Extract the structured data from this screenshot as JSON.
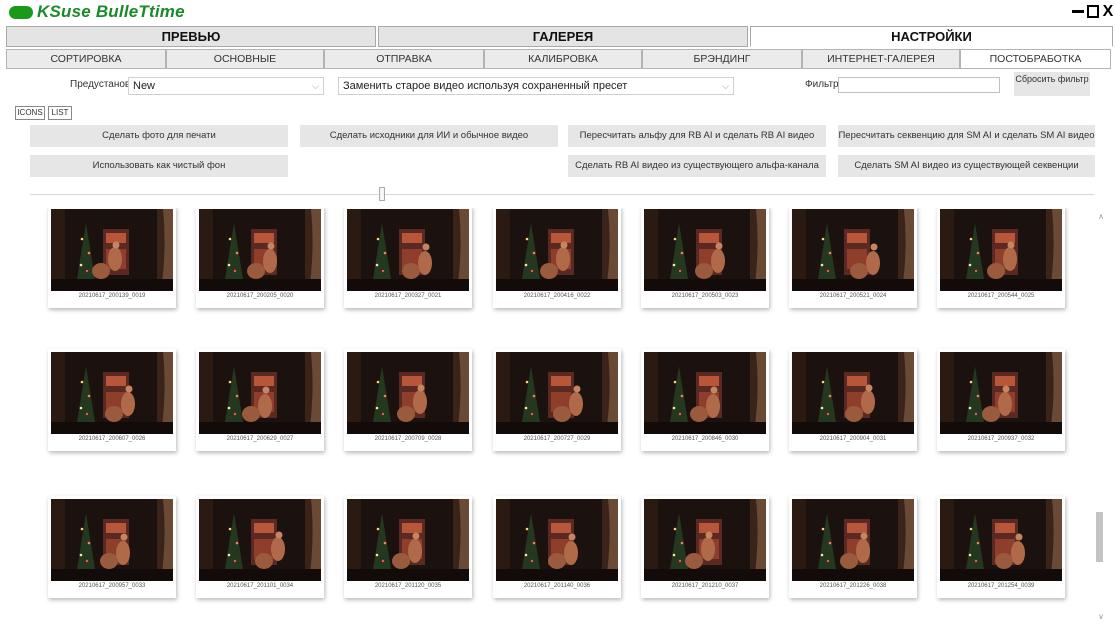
{
  "app": {
    "title": "KSuse BulleTtime",
    "logo_color": "#1a9a1a"
  },
  "window": {
    "minimize": "minimize-icon",
    "maximize": "maximize-icon",
    "close": "X"
  },
  "main_tabs": [
    {
      "label": "ПРЕВЬЮ",
      "active": false
    },
    {
      "label": "ГАЛЕРЕЯ",
      "active": false
    },
    {
      "label": "НАСТРОЙКИ",
      "active": true
    }
  ],
  "sub_tabs": [
    {
      "label": "СОРТИРОВКА"
    },
    {
      "label": "ОСНОВНЫЕ"
    },
    {
      "label": "ОТПРАВКА"
    },
    {
      "label": "КАЛИБРОВКА"
    },
    {
      "label": "БРЭНДИНГ"
    },
    {
      "label": "ИНТЕРНЕТ-ГАЛЕРЕЯ"
    },
    {
      "label": "ПОСТОБРАБОТКА",
      "active": true
    }
  ],
  "preset": {
    "label": "Предустановка",
    "value": "New",
    "mode_value": "Заменить старое видео используя сохраненный пресет"
  },
  "filter": {
    "label": "Фильтр",
    "value": "",
    "reset_label": "Сбросить фильтр"
  },
  "view_toggle": {
    "icons": "ICONS",
    "list": "LIST"
  },
  "actions": {
    "print_photo": "Сделать фото для печати",
    "sources_ai": "Сделать исходники для ИИ и обычное видео",
    "recalc_alpha": "Пересчитать альфу для RB AI и сделать RB AI видео",
    "recalc_seq": "Пересчитать секвенцию для SM AI и сделать SM AI видео",
    "clean_bg": "Использовать как чистый фон",
    "rb_from_alpha": "Сделать RB AI видео из существующего альфа-канала",
    "sm_from_seq": "Сделать SM AI видео из существующей секвенции"
  },
  "gallery": {
    "items": [
      "20210617_200139_0019",
      "20210617_200205_0020",
      "20210617_200327_0021",
      "20210617_200416_0022",
      "20210617_200503_0023",
      "20210617_200521_0024",
      "20210617_200544_0025",
      "20210617_200607_0026",
      "20210617_200629_0027",
      "20210617_200709_0028",
      "20210617_200727_0029",
      "20210617_200846_0030",
      "20210617_200904_0031",
      "20210617_200937_0032",
      "20210617_200957_0033",
      "20210617_201101_0034",
      "20210617_201120_0035",
      "20210617_201140_0036",
      "20210617_201210_0037",
      "20210617_201226_0038",
      "20210617_201254_0039"
    ]
  },
  "scroll_position": 0.8
}
